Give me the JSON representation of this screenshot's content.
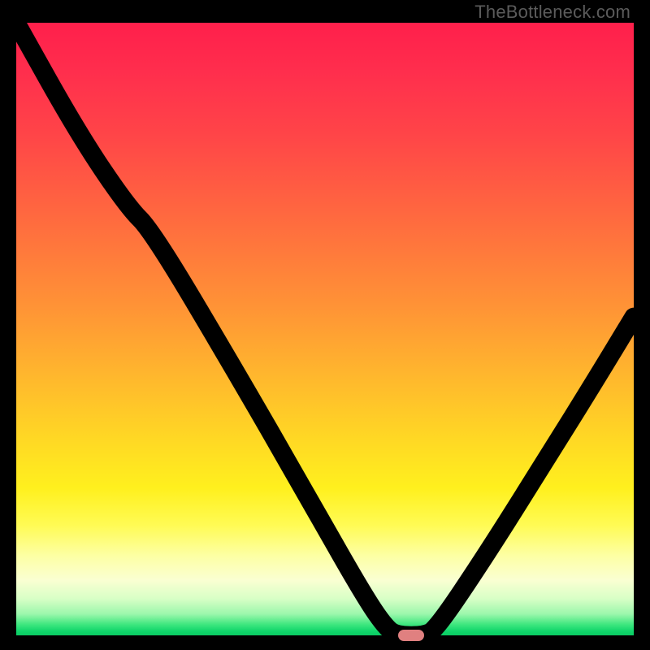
{
  "watermark": "TheBottleneck.com",
  "chart_data": {
    "type": "line",
    "title": "",
    "xlabel": "",
    "ylabel": "",
    "xlim": [
      0,
      100
    ],
    "ylim": [
      0,
      100
    ],
    "grid": false,
    "legend": false,
    "curve_points": [
      {
        "x": 0,
        "y": 100
      },
      {
        "x": 10,
        "y": 82
      },
      {
        "x": 18,
        "y": 70
      },
      {
        "x": 22,
        "y": 66
      },
      {
        "x": 35,
        "y": 44
      },
      {
        "x": 47,
        "y": 23
      },
      {
        "x": 56,
        "y": 7
      },
      {
        "x": 60,
        "y": 1
      },
      {
        "x": 62,
        "y": 0
      },
      {
        "x": 66,
        "y": 0
      },
      {
        "x": 68,
        "y": 1
      },
      {
        "x": 76,
        "y": 13
      },
      {
        "x": 86,
        "y": 29
      },
      {
        "x": 94,
        "y": 42
      },
      {
        "x": 100,
        "y": 52
      }
    ],
    "optimum_marker": {
      "x": 64,
      "y": 0
    },
    "background_gradient_stops": [
      {
        "pos": 0,
        "color": "#ff1f4b"
      },
      {
        "pos": 0.32,
        "color": "#ff6a3f"
      },
      {
        "pos": 0.58,
        "color": "#ffb82d"
      },
      {
        "pos": 0.76,
        "color": "#fff01e"
      },
      {
        "pos": 0.91,
        "color": "#faffd2"
      },
      {
        "pos": 0.985,
        "color": "#3fe77f"
      },
      {
        "pos": 1,
        "color": "#0acb63"
      }
    ]
  }
}
